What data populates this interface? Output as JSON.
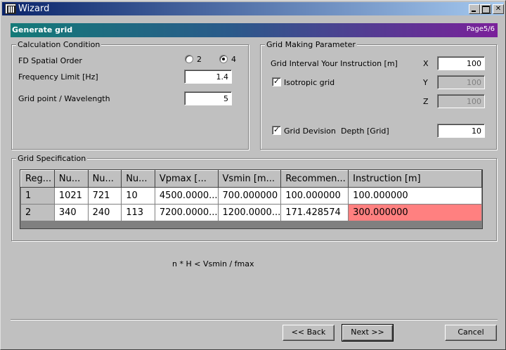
{
  "window": {
    "title": "Wizard"
  },
  "header": {
    "title": "Generate grid",
    "page": "Page5/6"
  },
  "calculation": {
    "title": "Calculation Condition",
    "fd_order_label": "FD Spatial Order",
    "fd_order_options": [
      "2",
      "4"
    ],
    "fd_order_selected": "4",
    "freq_label": "Frequency Limit [Hz]",
    "freq_value": "1.4",
    "wavelength_label": "Grid point / Wavelength",
    "wavelength_value": "5"
  },
  "grid_param": {
    "title": "Grid Making Parameter",
    "interval_label": "Grid Interval Your Instruction [m]",
    "x_label": "X",
    "x_value": "100",
    "y_label": "Y",
    "y_value": "100",
    "z_label": "Z",
    "z_value": "100",
    "isotropic_label": "Isotropic grid",
    "isotropic_checked": true,
    "division_label": "Grid Devision",
    "division_checked": true,
    "depth_label": "Depth [Grid]",
    "depth_value": "10"
  },
  "spec": {
    "title": "Grid Specification",
    "columns": [
      "Reg...",
      "Nu...",
      "Nu...",
      "Nu...",
      "Vpmax [...",
      "Vsmin [m...",
      "Recommen...",
      "Instruction [m]"
    ],
    "rows": [
      [
        "1",
        "1021",
        "721",
        "10",
        "4500.0000...",
        "700.000000",
        "100.000000",
        "100.000000"
      ],
      [
        "2",
        "340",
        "240",
        "113",
        "7200.0000...",
        "1200.0000...",
        "171.428574",
        "300.000000"
      ]
    ],
    "highlight_color": "#ff8080"
  },
  "formula": "n * H < Vsmin / fmax",
  "buttons": {
    "back": "<< Back",
    "next": "Next >>",
    "cancel": "Cancel"
  }
}
